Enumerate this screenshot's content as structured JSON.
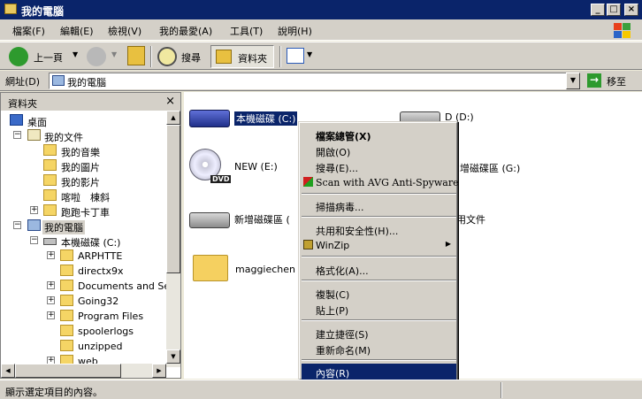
{
  "window": {
    "title": "我的電腦"
  },
  "menu": [
    "檔案(F)",
    "編輯(E)",
    "檢視(V)",
    "我的最愛(A)",
    "工具(T)",
    "說明(H)"
  ],
  "toolbar": {
    "back": "上一頁",
    "search": "搜尋",
    "folders": "資料夾"
  },
  "address": {
    "label": "網址(D)",
    "value": "我的電腦",
    "go": "移至"
  },
  "folderpane": {
    "title": "資料夾",
    "tree": [
      "桌面",
      "我的文件",
      "我的音樂",
      "我的圖片",
      "我的影片",
      "喀啦　棟斜",
      "跑跑卡丁車",
      "我的電腦",
      "本機磁碟 (C:)",
      "ARPHTTE",
      "directx9x",
      "Documents and Settin",
      "Going32",
      "Program Files",
      "spoolerlogs",
      "unzipped",
      "web"
    ]
  },
  "content": {
    "items": [
      "本機磁碟 (C:)",
      "D (D:)",
      "NEW (E:)",
      "增磁碟區 (G:)",
      "新增磁碟區 (",
      "用文件",
      "maggiechen 的"
    ],
    "dvd_label": "DVD"
  },
  "context_menu": [
    "檔案總管(X)",
    "開啟(O)",
    "搜尋(E)...",
    "Scan with AVG Anti-Spyware",
    "掃描病毒...",
    "共用和安全性(H)...",
    "WinZip",
    "格式化(A)...",
    "複製(C)",
    "貼上(P)",
    "建立捷徑(S)",
    "重新命名(M)",
    "內容(R)"
  ],
  "status": {
    "text": "顯示選定項目的內容。"
  }
}
